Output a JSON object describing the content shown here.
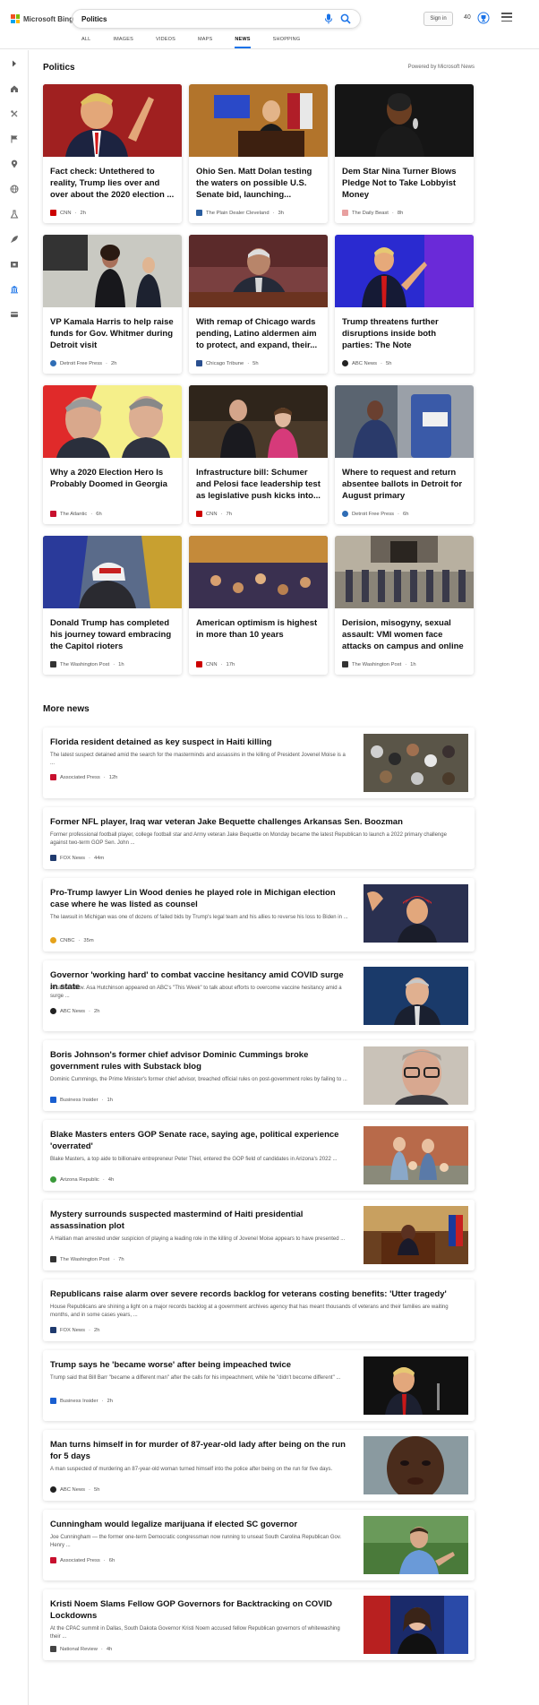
{
  "header": {
    "brand": "Microsoft Bing",
    "search_query": "Politics",
    "sign_in": "Sign in",
    "points": "40",
    "tabs": [
      {
        "label": "ALL",
        "active": false
      },
      {
        "label": "IMAGES",
        "active": false
      },
      {
        "label": "VIDEOS",
        "active": false
      },
      {
        "label": "MAPS",
        "active": false
      },
      {
        "label": "NEWS",
        "active": true
      },
      {
        "label": "SHOPPING",
        "active": false
      }
    ]
  },
  "sidebar": {
    "icons": [
      "expand-icon",
      "home-icon",
      "tools-icon",
      "flag-icon",
      "location-pin-icon",
      "globe-icon",
      "science-icon",
      "rocket-icon",
      "movie-icon",
      "bank-icon",
      "card-icon"
    ]
  },
  "main": {
    "title": "Politics",
    "powered_by": "Powered by Microsoft News",
    "cards": [
      {
        "title": "Fact check: Untethered to reality, Trump lies over and over about the 2020 election ...",
        "source": "CNN",
        "age": "2h",
        "logo_color": "#cc0000"
      },
      {
        "title": "Ohio Sen. Matt Dolan testing the waters on possible U.S. Senate bid, launching...",
        "source": "The Plain Dealer Cleveland",
        "age": "3h",
        "logo_color": "#2a5d9f"
      },
      {
        "title": "Dem Star Nina Turner Blows Pledge Not to Take Lobbyist Money",
        "source": "The Daily Beast",
        "age": "8h",
        "logo_color": "#e8a0a0"
      },
      {
        "title": "VP Kamala Harris to help raise funds for Gov. Whitmer during Detroit visit",
        "source": "Detroit Free Press",
        "age": "2h",
        "logo_color": "#2f6db5"
      },
      {
        "title": "With remap of Chicago wards pending, Latino aldermen aim to protect, and expand, their...",
        "source": "Chicago Tribune",
        "age": "5h",
        "logo_color": "#2a4f8f"
      },
      {
        "title": "Trump threatens further disruptions inside both parties: The Note",
        "source": "ABC News",
        "age": "5h",
        "logo_color": "#222222"
      },
      {
        "title": "Why a 2020 Election Hero Is Probably Doomed in Georgia",
        "source": "The Atlantic",
        "age": "6h",
        "logo_color": "#c8102e"
      },
      {
        "title": "Infrastructure bill: Schumer and Pelosi face leadership test as legislative push kicks into...",
        "source": "CNN",
        "age": "7h",
        "logo_color": "#cc0000"
      },
      {
        "title": "Where to request and return absentee ballots in Detroit for August primary",
        "source": "Detroit Free Press",
        "age": "6h",
        "logo_color": "#2f6db5"
      },
      {
        "title": "Donald Trump has completed his journey toward embracing the Capitol rioters",
        "source": "The Washington Post",
        "age": "1h",
        "logo_color": "#333333"
      },
      {
        "title": "American optimism is highest in more than 10 years",
        "source": "CNN",
        "age": "17h",
        "logo_color": "#cc0000"
      },
      {
        "title": "Derision, misogyny, sexual assault: VMI women face attacks on campus and online",
        "source": "The Washington Post",
        "age": "1h",
        "logo_color": "#333333"
      }
    ]
  },
  "more_news": {
    "title": "More news",
    "items": [
      {
        "title": "Florida resident detained as key suspect in Haiti killing",
        "snippet": "The latest suspect detained amid the search for the masterminds and assassins in the killing of President Jovenel Moise is a ...",
        "source": "Associated Press",
        "age": "12h",
        "logo_color": "#c8102e",
        "has_image": true
      },
      {
        "title": "Former NFL player, Iraq war veteran Jake Bequette challenges Arkansas Sen. Boozman",
        "snippet": "Former professional football player, college football star and Army veteran Jake Bequette on Monday became the latest Republican to launch a 2022 primary challenge against two-term GOP Sen. John ...",
        "source": "FOX News",
        "age": "44m",
        "logo_color": "#1f3a6e",
        "has_image": false
      },
      {
        "title": "Pro-Trump lawyer Lin Wood denies he played role in Michigan election case where he was listed as counsel",
        "snippet": "The lawsuit in Michigan was one of dozens of failed bids by Trump's legal team and his allies to reverse his loss to Biden in ...",
        "source": "CNBC",
        "age": "35m",
        "logo_color": "#e5a21b",
        "has_image": true
      },
      {
        "title": "Governor 'working hard' to combat vaccine hesitancy amid COVID surge in state",
        "snippet": "Arkansas Gov. Asa Hutchinson appeared on ABC's \"This Week\" to talk about efforts to overcome vaccine hesitancy amid a surge ...",
        "source": "ABC News",
        "age": "2h",
        "logo_color": "#222222",
        "has_image": true
      },
      {
        "title": "Boris Johnson's former chief advisor Dominic Cummings broke government rules with Substack blog",
        "snippet": "Dominic Cummings, the Prime Minister's former chief advisor, breached official rules on post-government roles by failing to ...",
        "source": "Business Insider",
        "age": "1h",
        "logo_color": "#1a5fd0",
        "has_image": true
      },
      {
        "title": "Blake Masters enters GOP Senate race, saying age, political experience 'overrated'",
        "snippet": "Blake Masters, a top aide to billionaire entrepreneur Peter Thiel, entered the GOP field of candidates in Arizona's 2022 ...",
        "source": "Arizona Republic",
        "age": "4h",
        "logo_color": "#3a9a3a",
        "has_image": true
      },
      {
        "title": "Mystery surrounds suspected mastermind of Haiti presidential assassination plot",
        "snippet": "A Haitian man arrested under suspicion of playing a leading role in the killing of Jovenel Moise appears to have presented ...",
        "source": "The Washington Post",
        "age": "7h",
        "logo_color": "#333333",
        "has_image": true
      },
      {
        "title": "Republicans raise alarm over severe records backlog for veterans costing benefits: 'Utter tragedy'",
        "snippet": "House Republicans are shining a light on a major records backlog at a government archives agency that has meant thousands of veterans and their families are waiting months, and in some cases years, ...",
        "source": "FOX News",
        "age": "2h",
        "logo_color": "#1f3a6e",
        "has_image": false
      },
      {
        "title": "Trump says he 'became worse' after being impeached twice",
        "snippet": "Trump said that Bill Barr \"became a different man\" after the calls for his impeachment, while he \"didn't become different\" ...",
        "source": "Business Insider",
        "age": "2h",
        "logo_color": "#1a5fd0",
        "has_image": true
      },
      {
        "title": "Man turns himself in for murder of 87-year-old lady after being on the run for 5 days",
        "snippet": "A man suspected of murdering an 87-year-old woman turned himself into the police after being on the run for five days.",
        "source": "ABC News",
        "age": "5h",
        "logo_color": "#222222",
        "has_image": true
      },
      {
        "title": "Cunningham would legalize marijuana if elected SC governor",
        "snippet": "Joe Cunningham — the former one-term Democratic congressman now running to unseat South Carolina Republican Gov. Henry ...",
        "source": "Associated Press",
        "age": "6h",
        "logo_color": "#c8102e",
        "has_image": true
      },
      {
        "title": "Kristi Noem Slams Fellow GOP Governors for Backtracking on COVID Lockdowns",
        "snippet": "At the CPAC summit in Dallas, South Dakota Governor Kristi Noem accused fellow Republican governors of whitewashing their ...",
        "source": "National Review",
        "age": "4h",
        "logo_color": "#444444",
        "has_image": true
      }
    ]
  }
}
